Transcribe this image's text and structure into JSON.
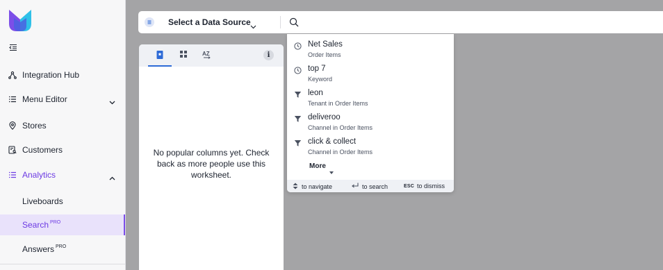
{
  "sidebar": {
    "items": [
      {
        "label": "Integration Hub",
        "icon": "integration-hub-icon"
      },
      {
        "label": "Menu Editor",
        "icon": "menu-list-icon",
        "expandable": true
      },
      {
        "label": "Stores",
        "icon": "map-pin-icon"
      },
      {
        "label": "Customers",
        "icon": "customers-icon"
      },
      {
        "label": "Analytics",
        "icon": "analytics-list-icon",
        "expandable": true,
        "expanded": true,
        "active": true
      }
    ],
    "analytics_children": [
      {
        "label": "Liveboards",
        "pro": ""
      },
      {
        "label": "Search",
        "pro": "PRO",
        "selected": true
      },
      {
        "label": "Answers",
        "pro": "PRO"
      }
    ]
  },
  "search_bar": {
    "data_source_label": "Select a Data Source",
    "query": ""
  },
  "left_panel": {
    "tabs": [
      "popular-columns-tab",
      "grid-view-tab",
      "alphabetical-sort-tab"
    ],
    "info_label": "i",
    "empty_message": "No popular columns yet. Check back as more people use this worksheet."
  },
  "suggestions": {
    "items": [
      {
        "title": "Net Sales",
        "subtitle": "Order Items",
        "icon": "recent-clock-icon"
      },
      {
        "title": "top 7",
        "subtitle": "Keyword",
        "icon": "recent-clock-icon"
      },
      {
        "title": "leon",
        "subtitle": "Tenant in Order Items",
        "icon": "filter-icon"
      },
      {
        "title": "deliveroo",
        "subtitle": "Channel in Order Items",
        "icon": "filter-icon"
      },
      {
        "title": "click & collect",
        "subtitle": "Channel in Order Items",
        "icon": "filter-icon"
      }
    ],
    "more_label": "More",
    "footer": {
      "navigate": "to navigate",
      "search": "to search",
      "dismiss_key": "ESC",
      "dismiss": "to dismiss"
    }
  },
  "colors": {
    "accent": "#6c3ae3",
    "tab_active": "#2d6ad6",
    "canvas": "#a4a4a6"
  }
}
